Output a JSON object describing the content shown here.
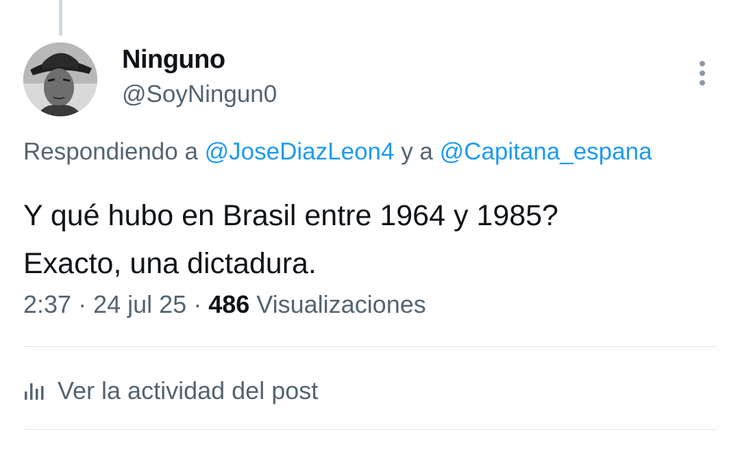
{
  "author": {
    "display_name": "Ninguno",
    "handle": "@SoyNingun0",
    "avatar_icon": "avatar-photo"
  },
  "reply": {
    "prefix": "Respondiendo a ",
    "mention_1": "@JoseDiazLeon4",
    "connector": " y a ",
    "mention_2": "@Capitana_espana"
  },
  "post": {
    "line_1": "Y qué hubo en Brasil entre 1964 y 1985?",
    "line_2": "Exacto, una dictadura."
  },
  "meta": {
    "time": "2:37",
    "separator": " · ",
    "date": "24 jul 25",
    "views_count": "486",
    "views_label": " Visualizaciones"
  },
  "actions": {
    "activity_label": "Ver la actividad del post",
    "activity_icon": "bar-chart-icon",
    "more_icon": "more-vertical-icon"
  },
  "colors": {
    "link": "#1d9bf0",
    "secondary_text": "#536471",
    "primary_text": "#0f1419"
  }
}
